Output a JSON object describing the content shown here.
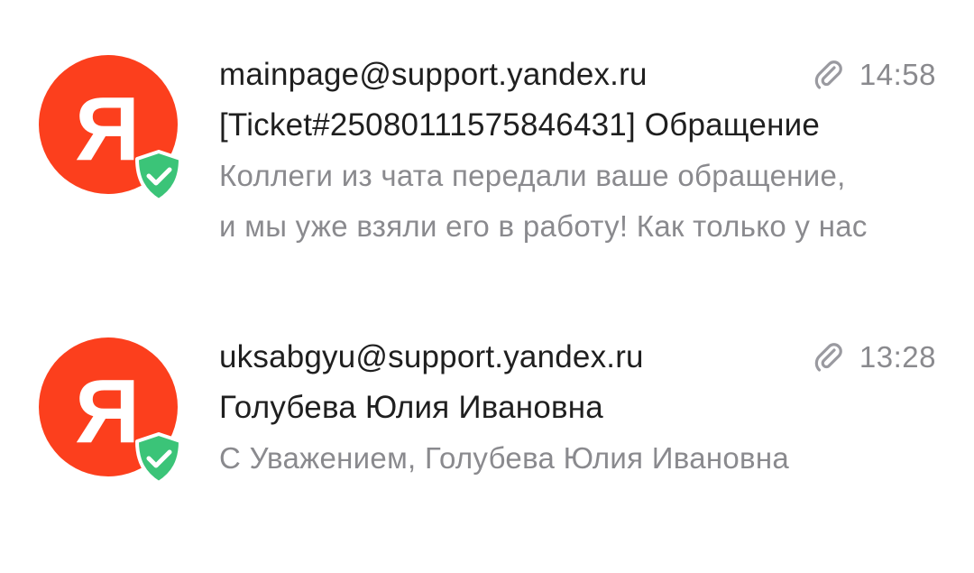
{
  "messages": [
    {
      "avatar_letter": "Я",
      "sender": "mainpage@support.yandex.ru",
      "time": "14:58",
      "has_attachment": true,
      "verified": true,
      "subject": "[Ticket#25080111575846431] Обращение",
      "snippet_line1": "Коллеги из чата передали ваше обращение,",
      "snippet_line2": "и мы уже взяли его в работу! Как только у нас"
    },
    {
      "avatar_letter": "Я",
      "sender": "uksabgyu@support.yandex.ru",
      "time": "13:28",
      "has_attachment": true,
      "verified": true,
      "subject": "Голубева Юлия Ивановна",
      "snippet_line1": "С Уважением, Голубева Юлия Ивановна"
    }
  ],
  "colors": {
    "avatar_bg": "#fc3f1d",
    "badge_green": "#3bc478",
    "primary_text": "#1f1f1f",
    "secondary_text": "#8a8a8e"
  },
  "icons": {
    "avatar": "yandex-ya-logo",
    "badge": "verified-shield-check-icon",
    "attachment": "paperclip-icon"
  }
}
